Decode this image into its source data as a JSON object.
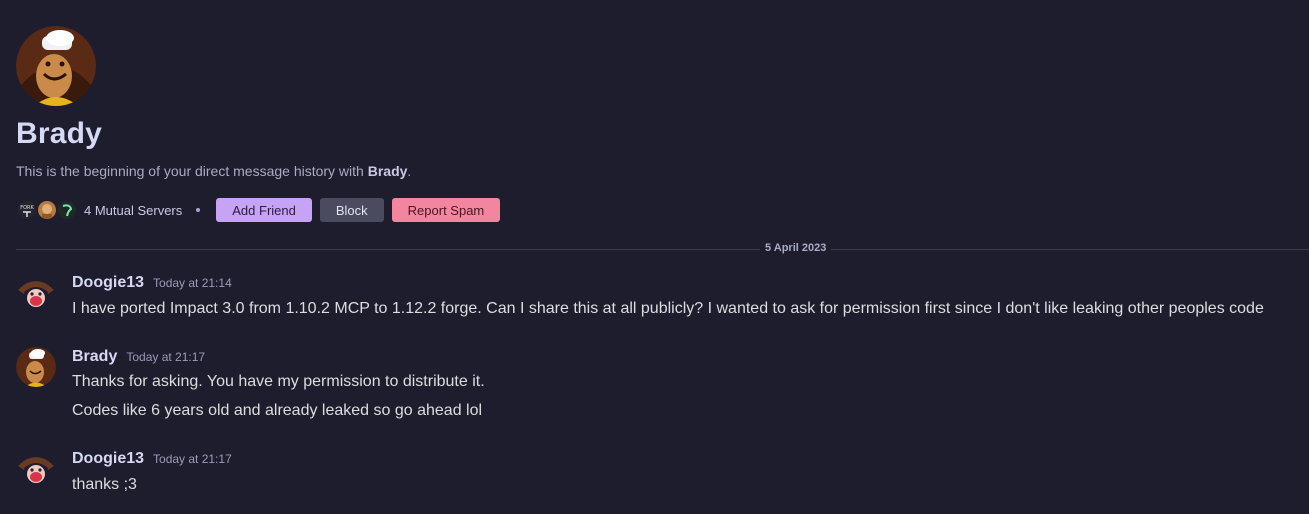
{
  "profile": {
    "name": "Brady",
    "intro_prefix": "This is the beginning of your direct message history with ",
    "intro_name": "Brady",
    "intro_suffix": ".",
    "mutual_servers": "4 Mutual Servers",
    "server_icon_text": "FORK"
  },
  "actions": {
    "add_friend": "Add Friend",
    "block": "Block",
    "report_spam": "Report Spam"
  },
  "divider": {
    "date": "5 April 2023"
  },
  "messages": [
    {
      "author": "Doogie13",
      "timestamp": "Today at 21:14",
      "lines": [
        "I have ported Impact 3.0 from 1.10.2 MCP to 1.12.2 forge. Can I share this at all publicly? I wanted to ask for permission first since I don't like leaking other peoples code"
      ]
    },
    {
      "author": "Brady",
      "timestamp": "Today at 21:17",
      "lines": [
        "Thanks for asking. You have my permission to distribute it.",
        "Codes like 6 years old and already leaked so go ahead lol"
      ]
    },
    {
      "author": "Doogie13",
      "timestamp": "Today at 21:17",
      "lines": [
        "thanks ;3"
      ]
    }
  ],
  "colors": {
    "background": "#1e1d2e",
    "add_friend": "#c7a3f5",
    "block": "#4a4b5e",
    "report_spam": "#f2869f"
  }
}
